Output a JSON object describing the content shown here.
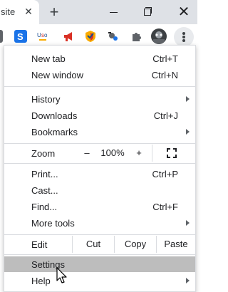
{
  "tab": {
    "title_fragment": "site p",
    "close_glyph": "✕"
  },
  "tabstrip": {
    "new_tab_glyph": "+",
    "close_glyph": "✕"
  },
  "extensions": [
    "s-extension-icon",
    "text-extension-icon",
    "megaphone-icon",
    "shield-icon",
    "bug-icon",
    "puzzle-icon",
    "avatar"
  ],
  "menu": {
    "items": {
      "new_tab": {
        "label": "New tab",
        "shortcut": "Ctrl+T"
      },
      "new_window": {
        "label": "New window",
        "shortcut": "Ctrl+N"
      },
      "history": {
        "label": "History"
      },
      "downloads": {
        "label": "Downloads",
        "shortcut": "Ctrl+J"
      },
      "bookmarks": {
        "label": "Bookmarks"
      },
      "print": {
        "label": "Print...",
        "shortcut": "Ctrl+P"
      },
      "cast": {
        "label": "Cast..."
      },
      "find": {
        "label": "Find...",
        "shortcut": "Ctrl+F"
      },
      "more_tools": {
        "label": "More tools"
      },
      "settings": {
        "label": "Settings"
      },
      "help": {
        "label": "Help"
      }
    },
    "zoom": {
      "label": "Zoom",
      "minus": "–",
      "value": "100%",
      "plus": "+"
    },
    "edit": {
      "label": "Edit",
      "cut": "Cut",
      "copy": "Copy",
      "paste": "Paste"
    }
  },
  "colors": {
    "tabstrip": "#dee1e6",
    "highlight": "#bdbdbd",
    "separator": "#dadce0",
    "text": "#202124"
  }
}
